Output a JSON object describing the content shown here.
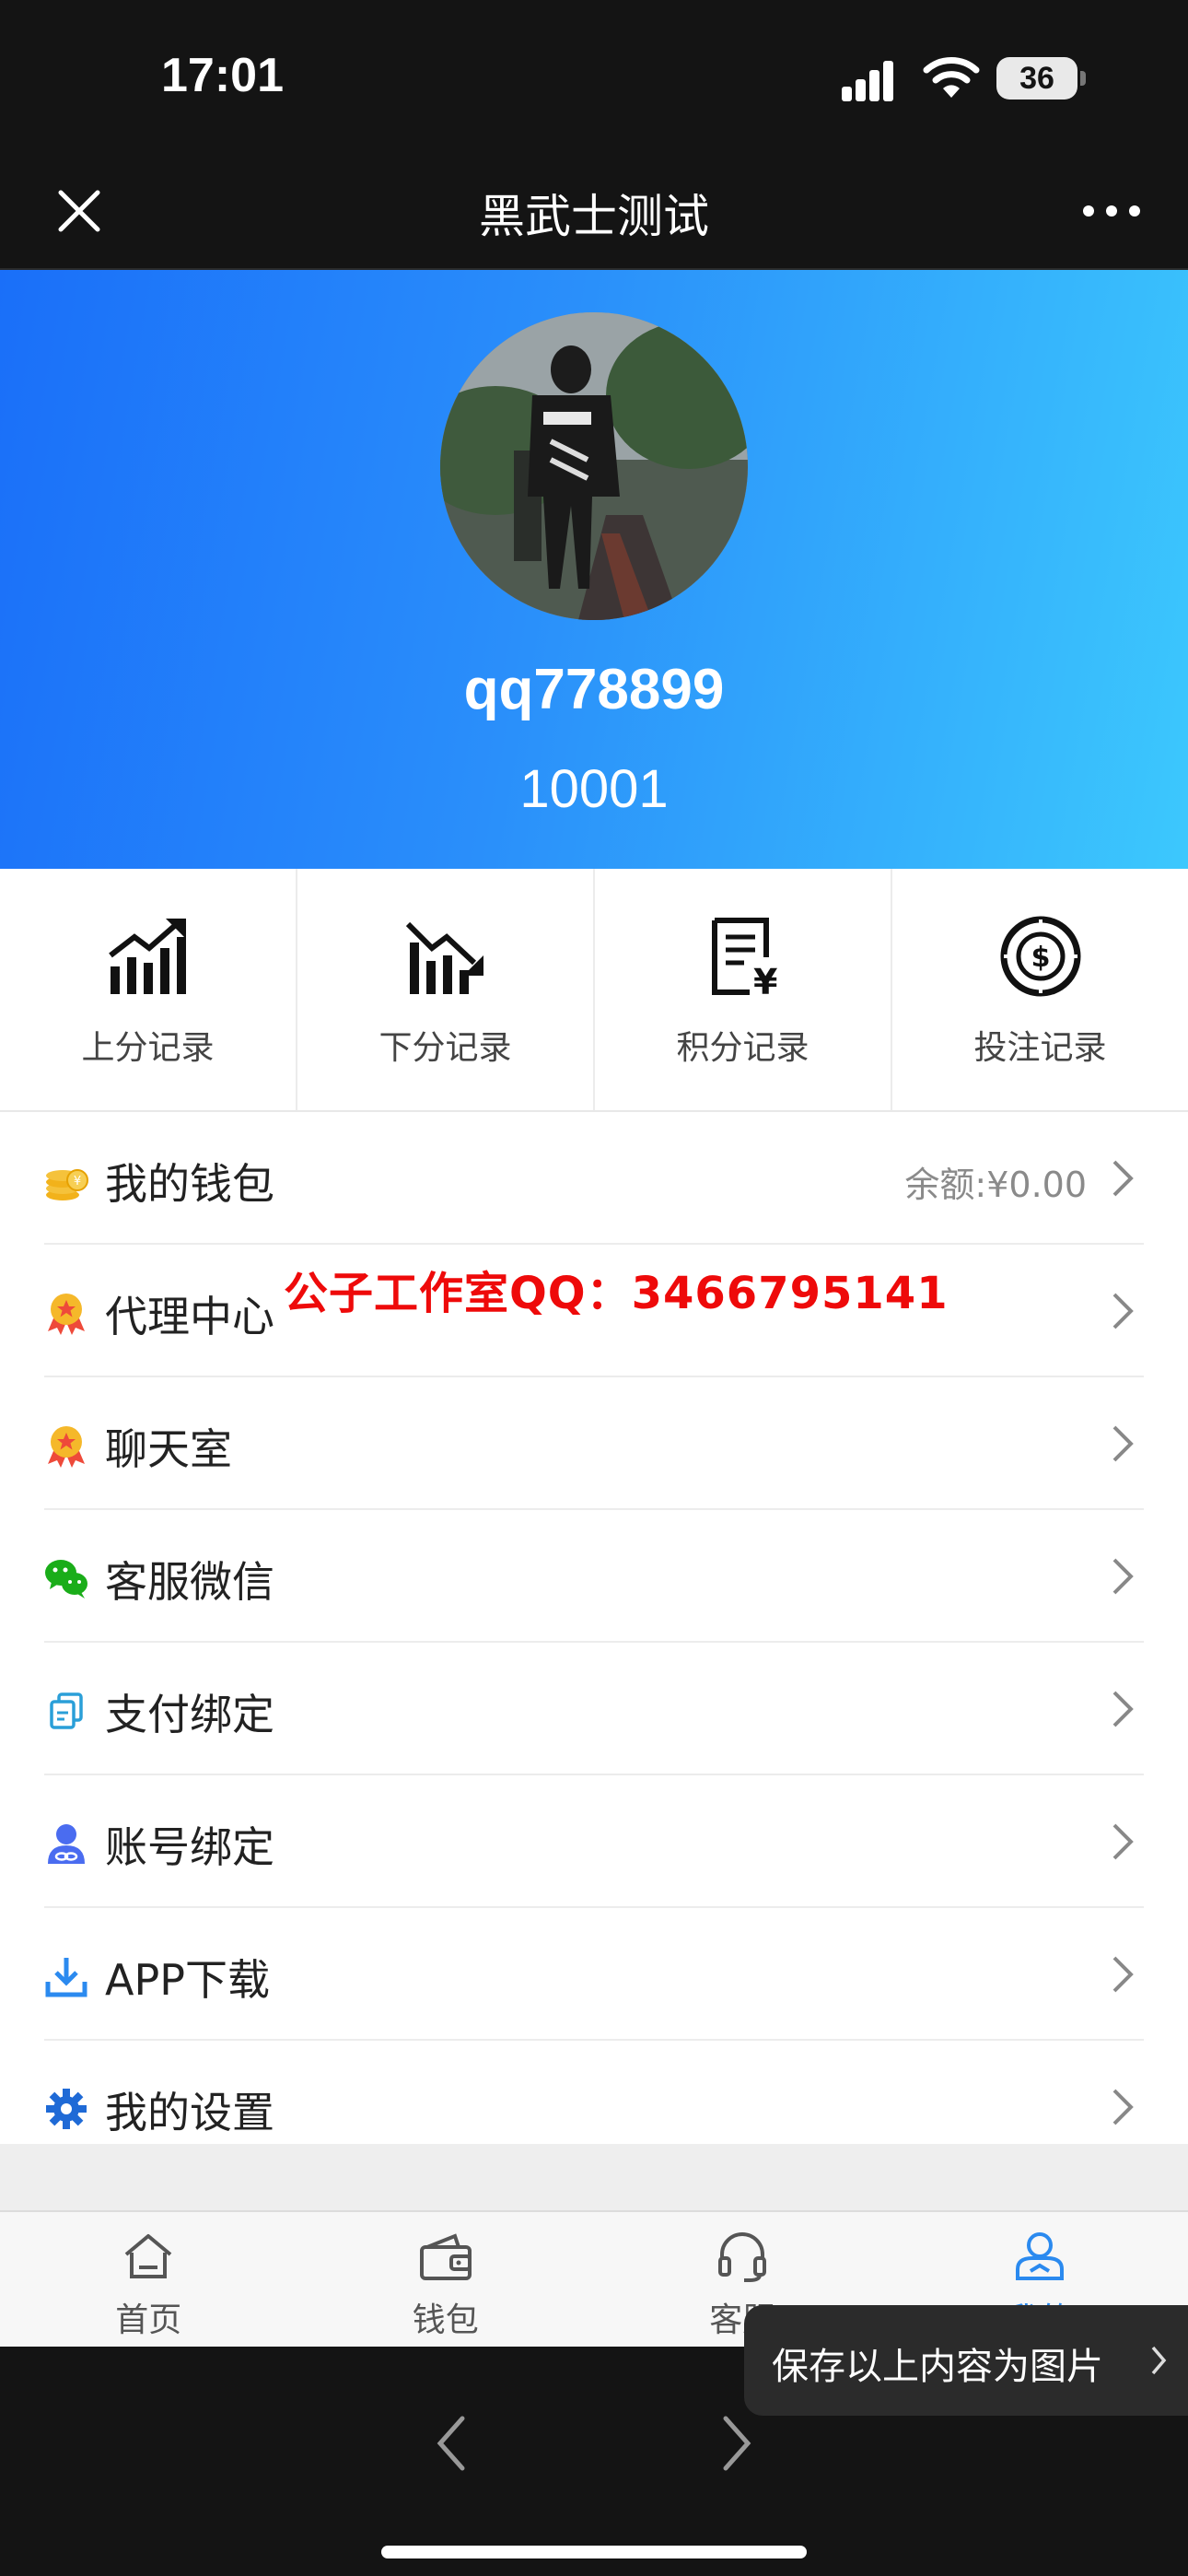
{
  "status_bar": {
    "time": "17:01",
    "battery": "36"
  },
  "nav": {
    "title": "黑武士测试"
  },
  "profile": {
    "username": "qq778899",
    "user_id": "10001"
  },
  "records": [
    {
      "label": "上分记录",
      "icon": "chart-up-icon"
    },
    {
      "label": "下分记录",
      "icon": "chart-down-icon"
    },
    {
      "label": "积分记录",
      "icon": "receipt-yen-icon"
    },
    {
      "label": "投注记录",
      "icon": "dollar-coin-icon"
    }
  ],
  "menu": [
    {
      "label": "我的钱包",
      "value": "余额:¥0.00",
      "icon": "coins-icon"
    },
    {
      "label": "代理中心",
      "value": "",
      "icon": "medal-icon"
    },
    {
      "label": "聊天室",
      "value": "",
      "icon": "medal-icon"
    },
    {
      "label": "客服微信",
      "value": "",
      "icon": "wechat-icon"
    },
    {
      "label": "支付绑定",
      "value": "",
      "icon": "copy-icon"
    },
    {
      "label": "账号绑定",
      "value": "",
      "icon": "user-link-icon"
    },
    {
      "label": "APP下载",
      "value": "",
      "icon": "download-icon"
    },
    {
      "label": "我的设置",
      "value": "",
      "icon": "gear-icon"
    }
  ],
  "watermark": "公子工作室QQ：3466795141",
  "tabs": [
    {
      "label": "首页",
      "icon": "home-icon"
    },
    {
      "label": "钱包",
      "icon": "wallet-icon"
    },
    {
      "label": "客服",
      "icon": "headset-icon"
    },
    {
      "label": "我的",
      "icon": "user-icon",
      "active": true
    }
  ],
  "toast": {
    "label": "保存以上内容为图片"
  },
  "colors": {
    "accent": "#2b8aef",
    "header_start": "#1a6ff9",
    "header_end": "#3cc8fd",
    "watermark": "#ee0a0a"
  }
}
